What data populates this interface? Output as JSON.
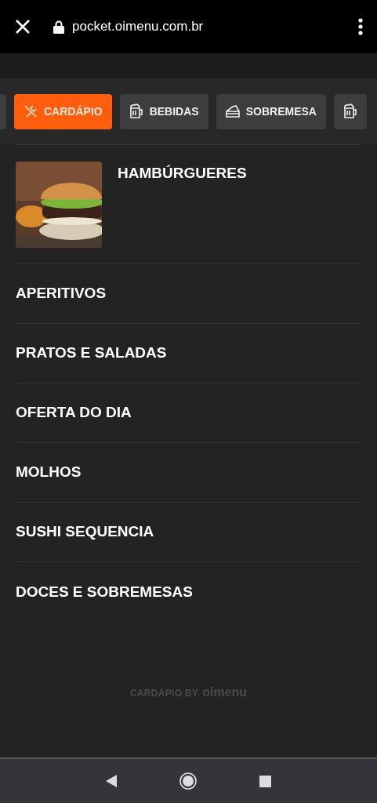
{
  "browser": {
    "url": "pocket.oimenu.com.br"
  },
  "tabs": [
    {
      "label": "CARDÁPIO",
      "kind": "cutlery",
      "selected": true
    },
    {
      "label": "BEBIDAS",
      "kind": "mug",
      "selected": false
    },
    {
      "label": "SOBREMESA",
      "kind": "cake",
      "selected": false
    },
    {
      "kind": "mug",
      "selected": false
    }
  ],
  "categories": [
    {
      "title": "HAMBÚRGUERES",
      "kind": "picture"
    },
    {
      "title": "APERITIVOS",
      "kind": "text"
    },
    {
      "title": "PRATOS E SALADAS",
      "kind": "text"
    },
    {
      "title": "OFERTA DO DIA",
      "kind": "text"
    },
    {
      "title": "MOLHOS",
      "kind": "text"
    },
    {
      "title": "SUSHI SEQUENCIA",
      "kind": "text"
    },
    {
      "title": "DOCES E SOBREMESAS",
      "kind": "text"
    }
  ],
  "footer": {
    "label": "CARDÁPIO BY",
    "brand": "oimenu"
  }
}
